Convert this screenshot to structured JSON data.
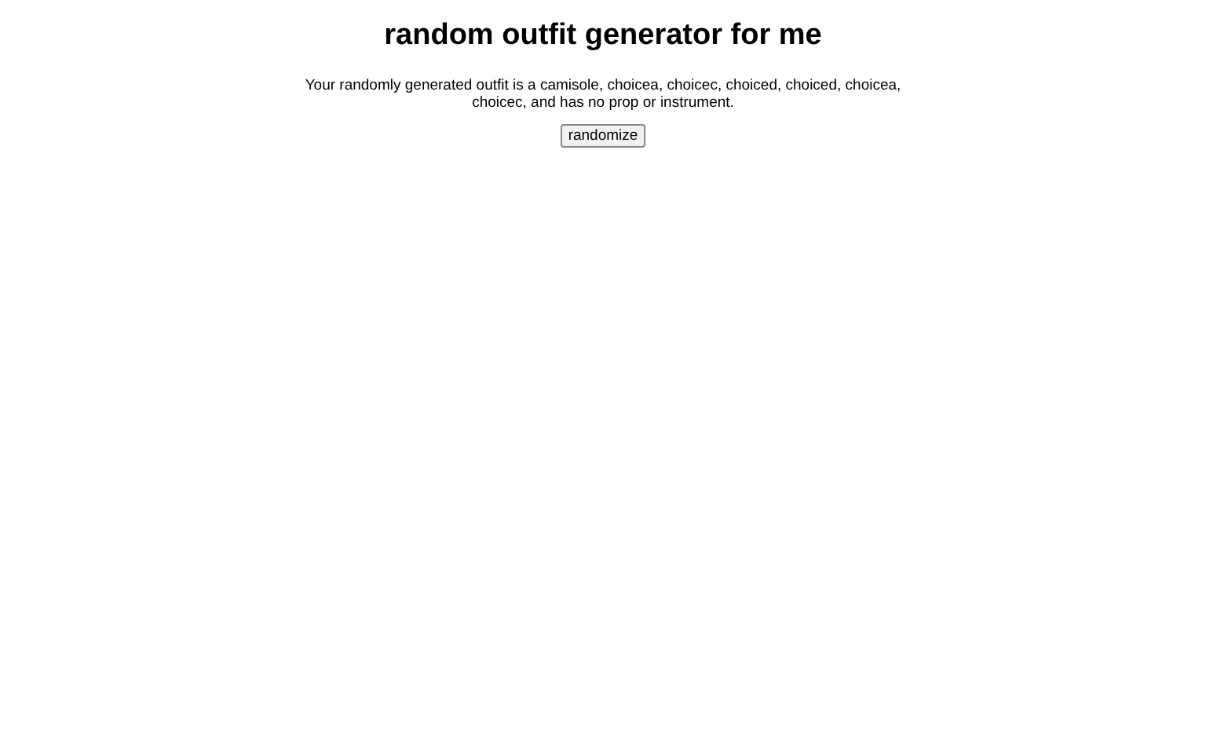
{
  "title": "random outfit generator for me",
  "result": "Your randomly generated outfit is a camisole, choicea, choicec, choiced, choiced, choicea, choicec, and has no prop or instrument.",
  "button": "randomize"
}
